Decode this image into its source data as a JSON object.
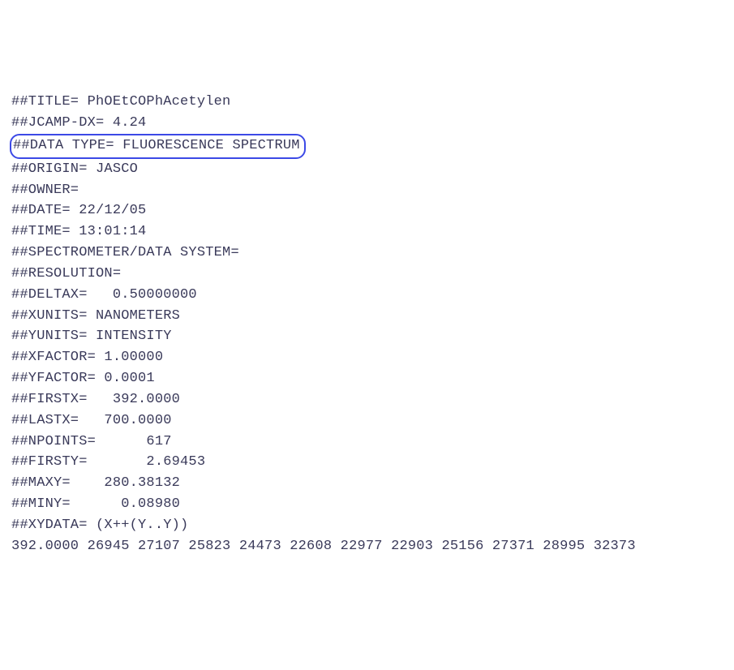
{
  "lines": {
    "l0": "##TITLE= PhOEtCOPhAcetylen",
    "l1": "##JCAMP-DX= 4.24",
    "l2": "##DATA TYPE= FLUORESCENCE SPECTRUM",
    "l3": "##ORIGIN= JASCO",
    "l4": "##OWNER=",
    "l5": "##DATE= 22/12/05",
    "l6": "##TIME= 13:01:14",
    "l7": "##SPECTROMETER/DATA SYSTEM=",
    "l8": "##RESOLUTION=",
    "l9": "##DELTAX=   0.50000000",
    "l10": "##XUNITS= NANOMETERS",
    "l11": "##YUNITS= INTENSITY",
    "l12": "##XFACTOR= 1.00000",
    "l13": "##YFACTOR= 0.0001",
    "l14": "##FIRSTX=   392.0000",
    "l15": "##LASTX=   700.0000",
    "l16": "##NPOINTS=      617",
    "l17": "##FIRSTY=       2.69453",
    "l18": "##MAXY=    280.38132",
    "l19": "##MINY=      0.08980",
    "l20": "##XYDATA= (X++(Y..Y))",
    "l21": "392.0000 26945 27107 25823 24473 22608 22977 22903 25156 27371 28995 32373"
  }
}
